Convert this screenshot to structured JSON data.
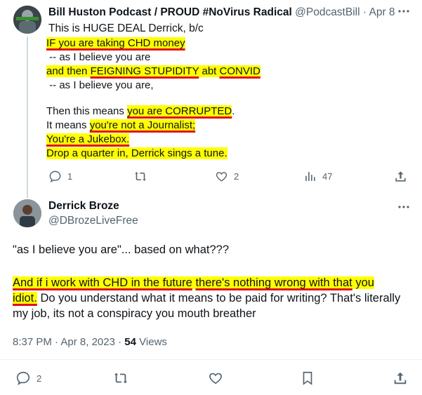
{
  "tweet1": {
    "author_name": "Bill Huston Podcast / PROUD #NoVirus Radical",
    "handle": "@PodcastBill",
    "separator": "·",
    "date": "Apr 8",
    "intro": "This is HUGE DEAL Derrick, b/c",
    "image_lines": [
      "IF you are taking CHD money",
      " -- as I believe you are",
      "and then FEIGNING STUPIDITY abt CONVID",
      " -- as I believe you are,",
      "Then this means you are CORRUPTED.",
      "It means you're not a Journalist;",
      "You're a Jukebox.",
      "Drop a quarter in, Derrick sings a tune."
    ],
    "image_fragments": {
      "l5_a": "Then this means ",
      "l5_b": "you are CORRUPTED",
      "l5_c": ".",
      "l6_a": "It means ",
      "l6_b": "you're not a Journalist;",
      "l3_a": "and then ",
      "l3_b": "FEIGNING STUPIDITY",
      "l3_c": " abt ",
      "l3_d": "CONVID"
    },
    "replies": "1",
    "retweets": "",
    "likes": "2",
    "views": "47"
  },
  "tweet2": {
    "author_name": "Derrick Broze",
    "handle": "@DBrozeLiveFree",
    "para1": "\"as I believe you are\"... based on what???",
    "para2_hl1": "And if i work with CHD in the future",
    "para2_space": " ",
    "para2_hl2": "there's nothing wrong with that",
    "para2_rest1": " you",
    "para2_hl3": "idiot.",
    "para2_rest2": " Do you understand what it means to be paid for writing? That's literally my job, its not a conspiracy you mouth breather",
    "time": "8:37 PM",
    "separator": "·",
    "date": "Apr 8, 2023",
    "separator2": "·",
    "views_count": "54",
    "views_label": "Views",
    "replies": "2"
  },
  "icons": {
    "more": "more-icon",
    "reply": "reply-icon",
    "retweet": "retweet-icon",
    "like": "like-icon",
    "views": "views-icon",
    "share": "share-icon",
    "bookmark": "bookmark-icon"
  },
  "colors": {
    "highlight": "#ffff00",
    "underline": "#e0101a",
    "muted": "#536471",
    "text": "#0f1419"
  }
}
